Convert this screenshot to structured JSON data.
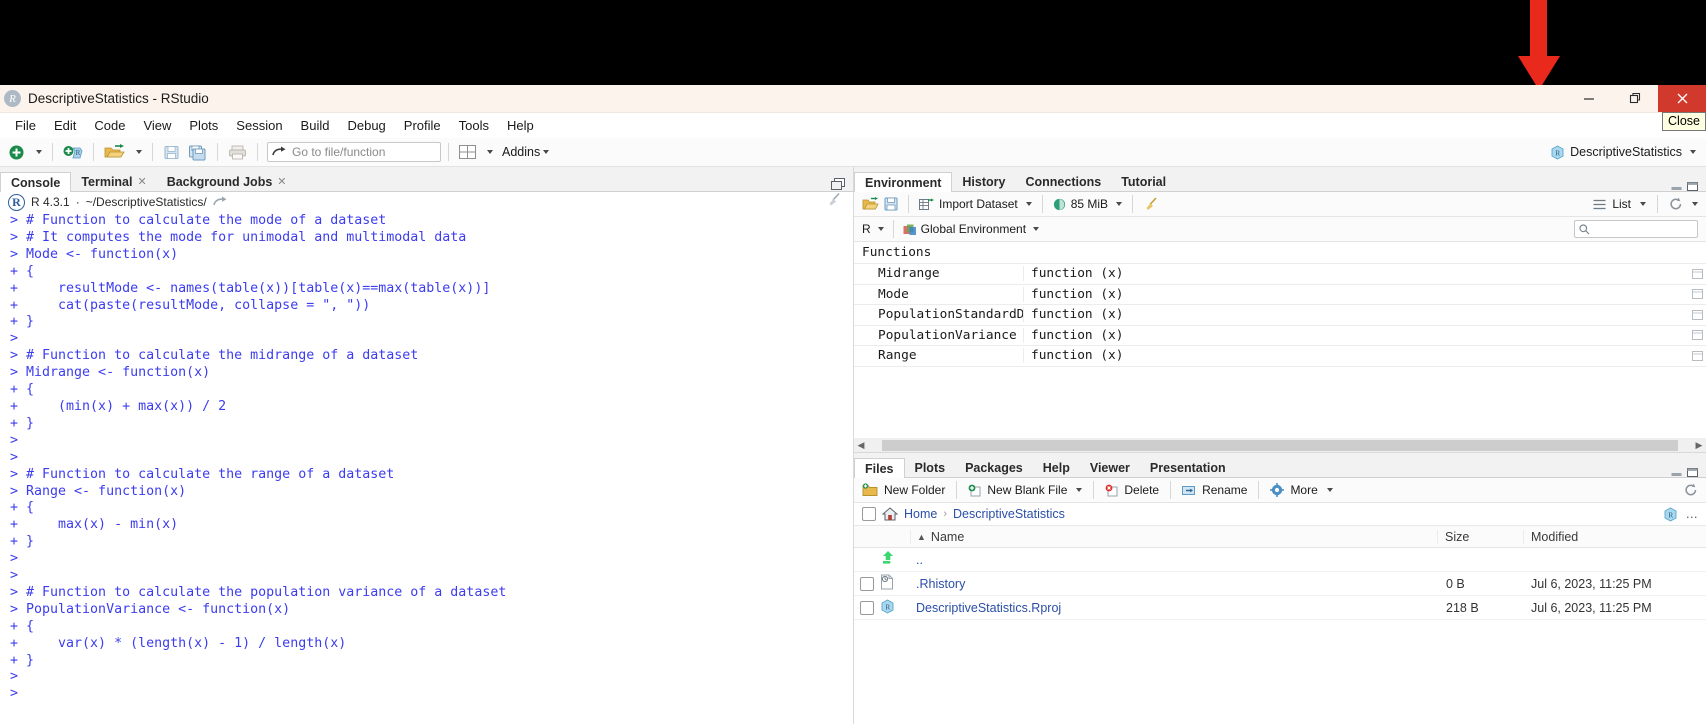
{
  "window": {
    "title": "DescriptiveStatistics - RStudio",
    "app_icon": "r-logo-icon",
    "minimize_label": "—",
    "maximize_label": "❐",
    "close_label": "✕",
    "close_tooltip": "Close"
  },
  "menubar": {
    "items": [
      "File",
      "Edit",
      "Code",
      "View",
      "Plots",
      "Session",
      "Build",
      "Debug",
      "Profile",
      "Tools",
      "Help"
    ]
  },
  "toolbar": {
    "goto_placeholder": "Go to file/function",
    "addins_label": "Addins",
    "project_label": "DescriptiveStatistics"
  },
  "console_pane": {
    "tabs": [
      {
        "label": "Console",
        "closable": false,
        "active": true
      },
      {
        "label": "Terminal",
        "closable": true,
        "active": false
      },
      {
        "label": "Background Jobs",
        "closable": true,
        "active": false
      }
    ],
    "r_version": "R 4.3.1",
    "working_dir": "~/DescriptiveStatistics/",
    "separator": "·",
    "lines": [
      "> # Function to calculate the mode of a dataset",
      "> # It computes the mode for unimodal and multimodal data",
      "> Mode <- function(x)",
      "+ {",
      "+     resultMode <- names(table(x))[table(x)==max(table(x))]",
      "+     cat(paste(resultMode, collapse = \", \"))",
      "+ }",
      ">",
      "> # Function to calculate the midrange of a dataset",
      "> Midrange <- function(x)",
      "+ {",
      "+     (min(x) + max(x)) / 2",
      "+ }",
      ">",
      ">",
      "> # Function to calculate the range of a dataset",
      "> Range <- function(x)",
      "+ {",
      "+     max(x) - min(x)",
      "+ }",
      ">",
      ">",
      "> # Function to calculate the population variance of a dataset",
      "> PopulationVariance <- function(x)",
      "+ {",
      "+     var(x) * (length(x) - 1) / length(x)",
      "+ }",
      ">",
      ">"
    ]
  },
  "environment_pane": {
    "tabs": [
      {
        "label": "Environment",
        "active": true
      },
      {
        "label": "History",
        "active": false
      },
      {
        "label": "Connections",
        "active": false
      },
      {
        "label": "Tutorial",
        "active": false
      }
    ],
    "toolbar": {
      "import_dataset_label": "Import Dataset",
      "memory_label": "85 MiB",
      "view_mode_label": "List"
    },
    "scope": {
      "language": "R",
      "environment_label": "Global Environment"
    },
    "search_placeholder": "",
    "group_label": "Functions",
    "rows": [
      {
        "name": "Midrange",
        "value": "function (x)"
      },
      {
        "name": "Mode",
        "value": "function (x)"
      },
      {
        "name": "PopulationStandardDe…",
        "value": "function (x)"
      },
      {
        "name": "PopulationVariance",
        "value": "function (x)"
      },
      {
        "name": "Range",
        "value": "function (x)"
      }
    ]
  },
  "files_pane": {
    "tabs": [
      {
        "label": "Files",
        "active": true
      },
      {
        "label": "Plots",
        "active": false
      },
      {
        "label": "Packages",
        "active": false
      },
      {
        "label": "Help",
        "active": false
      },
      {
        "label": "Viewer",
        "active": false
      },
      {
        "label": "Presentation",
        "active": false
      }
    ],
    "toolbar": {
      "new_folder_label": "New Folder",
      "new_blank_file_label": "New Blank File",
      "delete_label": "Delete",
      "rename_label": "Rename",
      "more_label": "More"
    },
    "breadcrumb": [
      "Home",
      "DescriptiveStatistics"
    ],
    "breadcrumb_separator": "›",
    "more_menu_label": "…",
    "columns": {
      "name": "Name",
      "size": "Size",
      "modified": "Modified",
      "sort_indicator": "▲"
    },
    "rows": [
      {
        "name": "..",
        "size": "",
        "modified": "",
        "icon": "up-folder-icon",
        "checkbox": false
      },
      {
        "name": ".Rhistory",
        "size": "0 B",
        "modified": "Jul 6, 2023, 11:25 PM",
        "icon": "history-file-icon",
        "checkbox": true
      },
      {
        "name": "DescriptiveStatistics.Rproj",
        "size": "218 B",
        "modified": "Jul 6, 2023, 11:25 PM",
        "icon": "rproj-file-icon",
        "checkbox": true
      }
    ]
  },
  "colors": {
    "console_text": "#3c3cf0",
    "close_button": "#d0392b",
    "link": "#2b4ea8",
    "arrow_annotation": "#e8291c",
    "titlebar_bg": "#fcf4ec"
  }
}
